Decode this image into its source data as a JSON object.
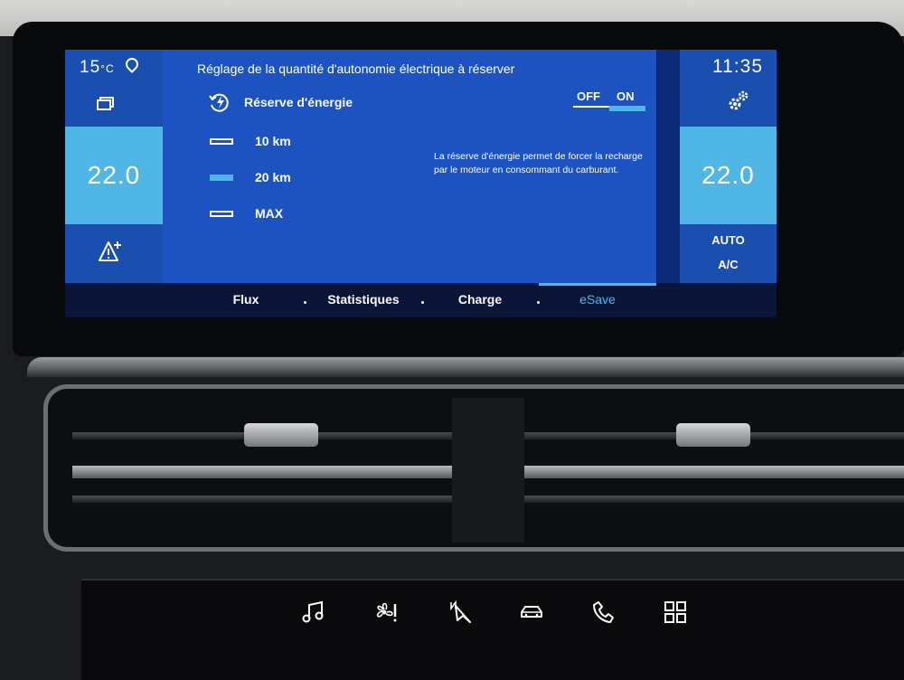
{
  "status": {
    "outside_temp": "15",
    "outside_temp_unit": "°C",
    "clock": "11:35"
  },
  "climate": {
    "left_temp": "22.0",
    "right_temp": "22.0",
    "auto_label": "AUTO",
    "ac_label": "A/C"
  },
  "esave": {
    "title": "Réglage de la quantité d'autonomie électrique à réserver",
    "reserve_label": "Réserve d'énergie",
    "toggle_off": "OFF",
    "toggle_on": "ON",
    "toggle_state": "ON",
    "options": [
      {
        "label": "10 km",
        "selected": false
      },
      {
        "label": "20 km",
        "selected": true
      },
      {
        "label": "MAX",
        "selected": false
      }
    ],
    "description": "La réserve d'énergie permet de forcer la recharge par le moteur en consommant du carburant."
  },
  "tabs": [
    {
      "label": "Flux",
      "active": false
    },
    {
      "label": "Statistiques",
      "active": false
    },
    {
      "label": "Charge",
      "active": false
    },
    {
      "label": "eSave",
      "active": true
    }
  ],
  "colors": {
    "accent": "#4fb6e6",
    "panel": "#1c53c0",
    "screen_bg": "#0c2a78"
  },
  "hard_keys": [
    "music-icon",
    "fan-icon",
    "navigation-icon",
    "car-icon",
    "phone-icon",
    "apps-grid-icon"
  ]
}
